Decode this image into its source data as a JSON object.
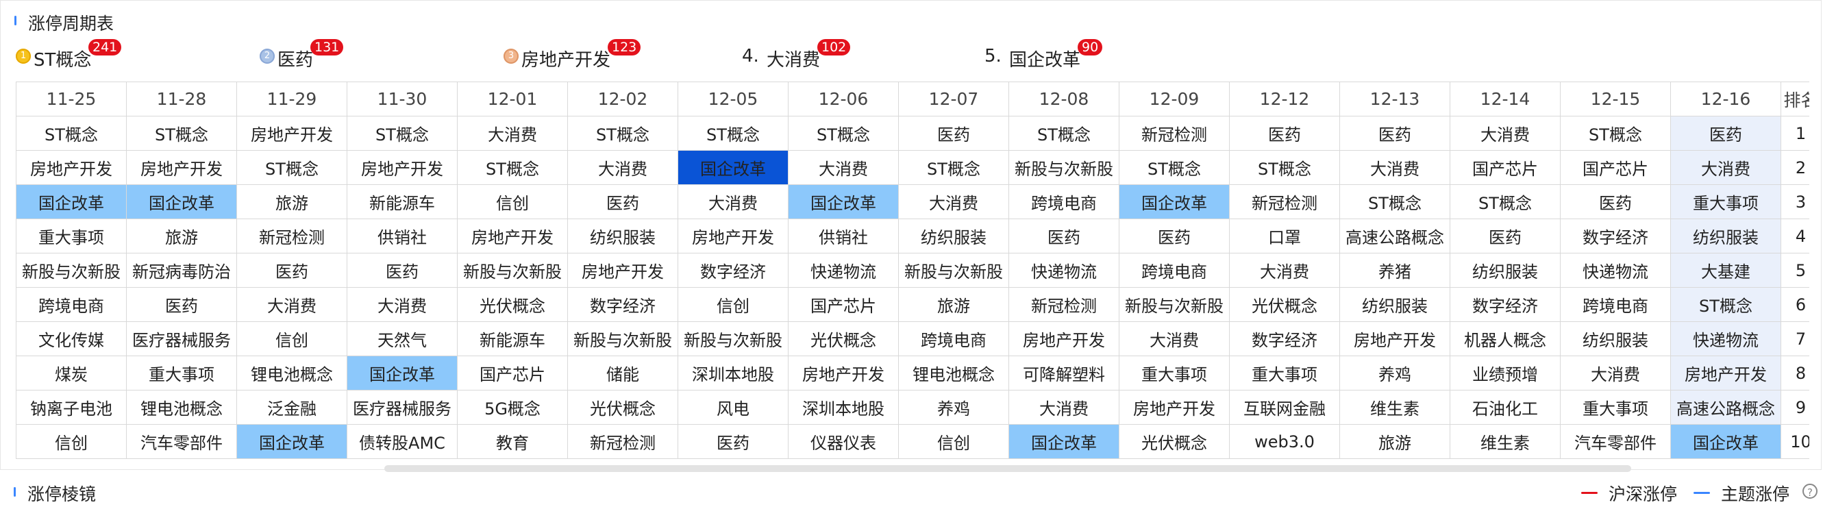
{
  "panel": {
    "title": "涨停周期表"
  },
  "top5": [
    {
      "rank": "1",
      "name": "ST概念",
      "count": "241",
      "medal": "gold"
    },
    {
      "rank": "2",
      "name": "医药",
      "count": "131",
      "medal": "silver"
    },
    {
      "rank": "3",
      "name": "房地产开发",
      "count": "123",
      "medal": "bronze"
    },
    {
      "rank": "4.",
      "name": "大消费",
      "count": "102",
      "medal": ""
    },
    {
      "rank": "5.",
      "name": "国企改革",
      "count": "90",
      "medal": ""
    }
  ],
  "table": {
    "dates": [
      "11-25",
      "11-28",
      "11-29",
      "11-30",
      "12-01",
      "12-02",
      "12-05",
      "12-06",
      "12-07",
      "12-08",
      "12-09",
      "12-12",
      "12-13",
      "12-14",
      "12-15",
      "12-16"
    ],
    "rank_header": "排名",
    "active_col": 15,
    "rows": [
      [
        "ST概念",
        "ST概念",
        "房地产开发",
        "ST概念",
        "大消费",
        "ST概念",
        "ST概念",
        "ST概念",
        "医药",
        "ST概念",
        "新冠检测",
        "医药",
        "医药",
        "大消费",
        "ST概念",
        "医药"
      ],
      [
        "房地产开发",
        "房地产开发",
        "ST概念",
        "房地产开发",
        "ST概念",
        "大消费",
        "国企改革",
        "大消费",
        "ST概念",
        "新股与次新股",
        "ST概念",
        "ST概念",
        "大消费",
        "国产芯片",
        "国产芯片",
        "大消费"
      ],
      [
        "国企改革",
        "国企改革",
        "旅游",
        "新能源车",
        "信创",
        "医药",
        "大消费",
        "国企改革",
        "大消费",
        "跨境电商",
        "国企改革",
        "新冠检测",
        "ST概念",
        "ST概念",
        "医药",
        "重大事项"
      ],
      [
        "重大事项",
        "旅游",
        "新冠检测",
        "供销社",
        "房地产开发",
        "纺织服装",
        "房地产开发",
        "供销社",
        "纺织服装",
        "医药",
        "医药",
        "口罩",
        "高速公路概念",
        "医药",
        "数字经济",
        "纺织服装"
      ],
      [
        "新股与次新股",
        "新冠病毒防治",
        "医药",
        "医药",
        "新股与次新股",
        "房地产开发",
        "数字经济",
        "快递物流",
        "新股与次新股",
        "快递物流",
        "跨境电商",
        "大消费",
        "养猪",
        "纺织服装",
        "快递物流",
        "大基建"
      ],
      [
        "跨境电商",
        "医药",
        "大消费",
        "大消费",
        "光伏概念",
        "数字经济",
        "信创",
        "国产芯片",
        "旅游",
        "新冠检测",
        "新股与次新股",
        "光伏概念",
        "纺织服装",
        "数字经济",
        "跨境电商",
        "ST概念"
      ],
      [
        "文化传媒",
        "医疗器械服务",
        "信创",
        "天然气",
        "新能源车",
        "新股与次新股",
        "新股与次新股",
        "光伏概念",
        "跨境电商",
        "房地产开发",
        "大消费",
        "数字经济",
        "房地产开发",
        "机器人概念",
        "纺织服装",
        "快递物流"
      ],
      [
        "煤炭",
        "重大事项",
        "锂电池概念",
        "国企改革",
        "国产芯片",
        "储能",
        "深圳本地股",
        "房地产开发",
        "锂电池概念",
        "可降解塑料",
        "重大事项",
        "重大事项",
        "养鸡",
        "业绩预增",
        "大消费",
        "房地产开发"
      ],
      [
        "钠离子电池",
        "锂电池概念",
        "泛金融",
        "医疗器械服务",
        "5G概念",
        "光伏概念",
        "风电",
        "深圳本地股",
        "养鸡",
        "大消费",
        "房地产开发",
        "互联网金融",
        "维生素",
        "石油化工",
        "重大事项",
        "高速公路概念"
      ],
      [
        "信创",
        "汽车零部件",
        "国企改革",
        "债转股AMC",
        "教育",
        "新冠检测",
        "医药",
        "仪器仪表",
        "信创",
        "国企改革",
        "光伏概念",
        "web3.0",
        "旅游",
        "维生素",
        "汽车零部件",
        "国企改革"
      ]
    ],
    "ranks": [
      "1",
      "2",
      "3",
      "4",
      "5",
      "6",
      "7",
      "8",
      "9",
      "10"
    ],
    "highlights": {
      "1-6": "dark",
      "2-0": "light",
      "2-1": "light",
      "2-7": "light",
      "2-10": "light",
      "7-3": "light",
      "9-2": "light",
      "9-9": "light",
      "9-15": "light"
    }
  },
  "footer": {
    "title": "涨停棱镜",
    "legend": [
      {
        "label": "沪深涨停",
        "color": "#e3121c"
      },
      {
        "label": "主题涨停",
        "color": "#3a86ff"
      }
    ],
    "help": "?"
  }
}
